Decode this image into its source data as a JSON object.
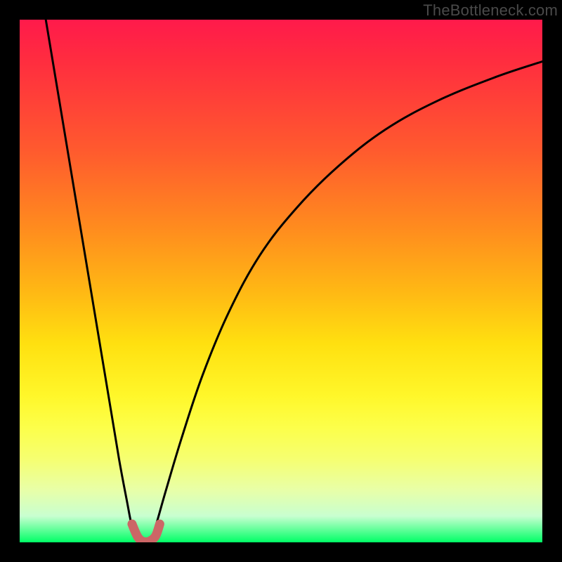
{
  "watermark": "TheBottleneck.com",
  "chart_data": {
    "type": "line",
    "title": "",
    "xlabel": "",
    "ylabel": "",
    "xlim": [
      0,
      100
    ],
    "ylim": [
      0,
      100
    ],
    "grid": false,
    "legend": false,
    "comfort_band_y": 92,
    "series": [
      {
        "name": "left-curve",
        "color": "#000000",
        "x": [
          5,
          7,
          9,
          11,
          13,
          15,
          17,
          19,
          20.5,
          21.5,
          22.5,
          23
        ],
        "y": [
          100,
          88,
          76,
          64,
          52,
          40,
          28,
          16,
          8,
          3,
          0.5,
          0
        ]
      },
      {
        "name": "right-curve",
        "color": "#000000",
        "x": [
          25,
          26,
          28,
          31,
          35,
          40,
          46,
          53,
          61,
          70,
          80,
          91,
          100
        ],
        "y": [
          0,
          3,
          10,
          20,
          32,
          44,
          55,
          64,
          72,
          79,
          84.5,
          89,
          92
        ]
      },
      {
        "name": "dip-marker",
        "color": "#cc6666",
        "x": [
          21.5,
          22.5,
          23.5,
          24.8,
          26,
          26.8
        ],
        "y": [
          3.5,
          1.2,
          0.2,
          0.2,
          1.2,
          3.5
        ]
      }
    ]
  }
}
